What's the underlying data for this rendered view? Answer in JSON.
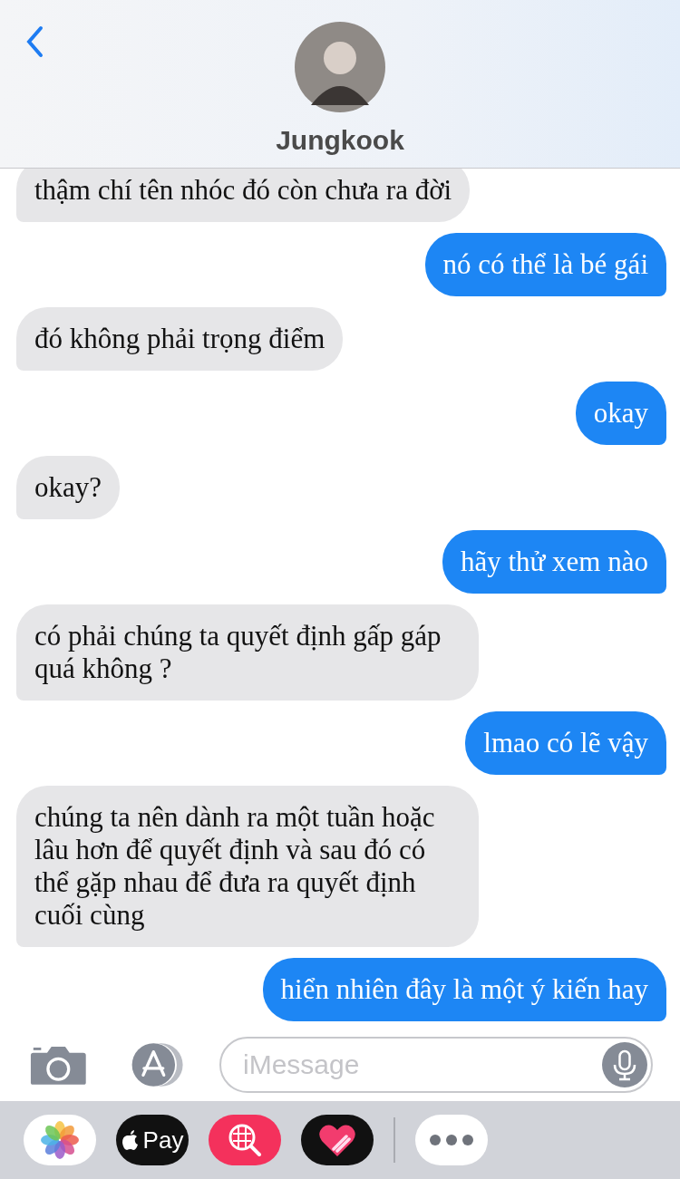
{
  "header": {
    "contact_name": "Jungkook"
  },
  "messages": [
    {
      "kind": "received",
      "text": "thậm chí tên nhóc đó còn chưa ra đời"
    },
    {
      "kind": "sent",
      "text": "nó có thể là bé gái"
    },
    {
      "kind": "received",
      "text": "đó không phải trọng điểm"
    },
    {
      "kind": "sent",
      "text": "okay"
    },
    {
      "kind": "received",
      "text": "okay?"
    },
    {
      "kind": "sent",
      "text": "hãy thử xem nào"
    },
    {
      "kind": "received",
      "text": "có phải chúng ta quyết định gấp gáp quá không ?"
    },
    {
      "kind": "sent",
      "text": "lmao có lẽ vậy"
    },
    {
      "kind": "received",
      "text": "chúng ta nên dành ra một tuần hoặc lâu hơn để quyết định và sau đó có thể gặp nhau để đưa ra quyết định cuối cùng"
    },
    {
      "kind": "sent",
      "text": "hiển nhiên đây là một ý kiến hay"
    }
  ],
  "composer": {
    "placeholder": "iMessage"
  },
  "app_drawer": [
    {
      "kind": "photos"
    },
    {
      "kind": "pay",
      "label": "Pay"
    },
    {
      "kind": "search"
    },
    {
      "kind": "heart"
    },
    {
      "kind": "more"
    }
  ]
}
